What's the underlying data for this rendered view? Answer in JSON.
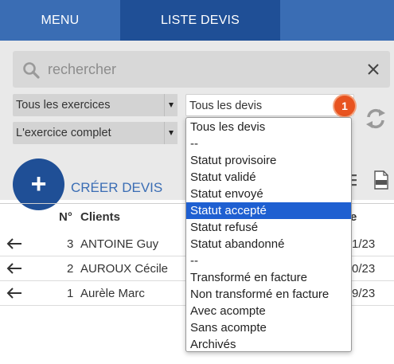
{
  "tabs": [
    {
      "label": "MENU"
    },
    {
      "label": "LISTE DEVIS"
    }
  ],
  "search": {
    "placeholder": "rechercher"
  },
  "filters": {
    "exercices": "Tous les exercices",
    "periode": "L'exercice complet",
    "devis": "Tous les devis"
  },
  "badge": "1",
  "create": {
    "plus": "+",
    "label": "CRÉER DEVIS"
  },
  "table": {
    "headers": {
      "num": "N°",
      "client": "Clients",
      "date": "e"
    },
    "rows": [
      {
        "num": "3",
        "client": "ANTOINE Guy",
        "date": "1/23"
      },
      {
        "num": "2",
        "client": "AUROUX Cécile",
        "date": "0/23"
      },
      {
        "num": "1",
        "client": "Aurèle Marc",
        "date": "9/23"
      }
    ]
  },
  "dropdown": {
    "selected_index": 5,
    "options": [
      "Tous les devis",
      "--",
      "Statut provisoire",
      "Statut validé",
      "Statut envoyé",
      "Statut accepté",
      "Statut refusé",
      "Statut abandonné",
      "--",
      "Transformé en facture",
      "Non transformé en facture",
      "Avec acompte",
      "Sans acompte",
      "Archivés"
    ]
  },
  "colors": {
    "tab_bar": "#3a6db4",
    "tab_active": "#1f4f96",
    "badge": "#e8531f",
    "selected_option": "#1e5fd1"
  }
}
